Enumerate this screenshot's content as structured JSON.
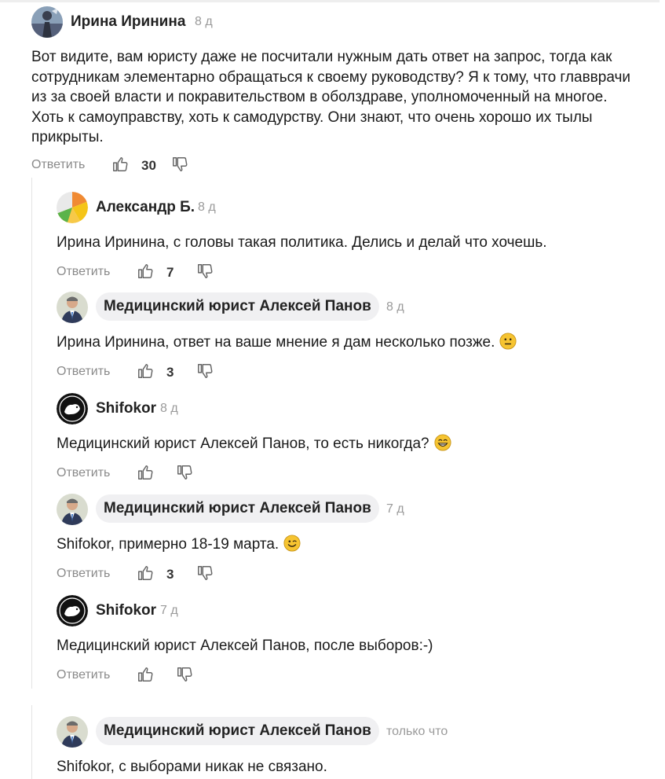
{
  "labels": {
    "reply": "Ответить"
  },
  "comments": [
    {
      "author": "Ирина Иринина",
      "time": "8 д",
      "text": "Вот видите, вам юристу даже не посчитали нужным дать ответ на запрос, тогда как сотрудникам элементарно обращаться к своему руководству? Я к тому, что главврачи из за своей власти и покравительством в оболздраве, уполномоченный на многое. Хоть к самоуправству, хоть к самодурству. Они знают, что очень хорошо их тылы прикрыты.",
      "likes": "30"
    },
    {
      "author": "Александр Б.",
      "time": "8 д",
      "text": "Ирина Иринина, с головы такая политика. Делись и делай что хочешь.",
      "likes": "7"
    },
    {
      "author": "Медицинский юрист Алексей Панов",
      "time": "8 д",
      "text": "Ирина Иринина, ответ на ваше мнение я дам несколько позже.",
      "emoji": "neutral-face",
      "likes": "3"
    },
    {
      "author": "Shifokor",
      "time": "8 д",
      "text": "Медицинский юрист Алексей Панов, то есть никогда?",
      "emoji": "grinning-face",
      "likes": ""
    },
    {
      "author": "Медицинский юрист Алексей Панов",
      "time": "7 д",
      "text": "Shifokor, примерно 18-19 марта.",
      "emoji": "winking-face",
      "likes": "3"
    },
    {
      "author": "Shifokor",
      "time": "7 д",
      "text": "Медицинский юрист Алексей Панов, после выборов:-)",
      "likes": ""
    },
    {
      "author": "Медицинский юрист Алексей Панов",
      "time": "только что",
      "text": "Shifokor, с выборами никак не связано."
    }
  ],
  "icons": {
    "like": "thumbs-up-icon",
    "dislike": "thumbs-down-icon"
  },
  "colors": {
    "text": "#1a1a1a",
    "muted": "#8a8a8a",
    "pill_bg": "#f0f0f2",
    "emoji": "#f6c431"
  }
}
